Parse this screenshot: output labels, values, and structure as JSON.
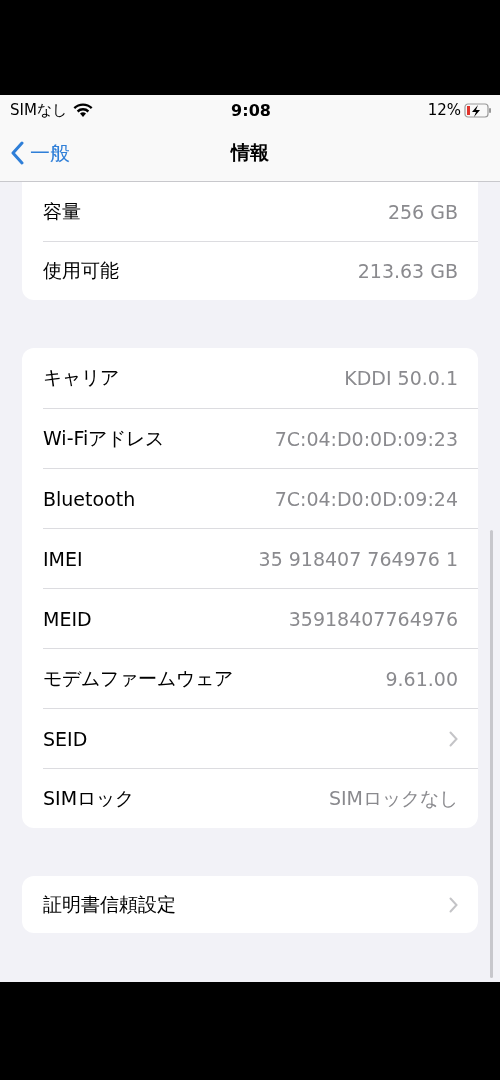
{
  "status_bar": {
    "carrier": "SIMなし",
    "time": "9:08",
    "battery": "12%",
    "charging": true
  },
  "nav": {
    "back": "一般",
    "title": "情報"
  },
  "groups": [
    {
      "rows": [
        {
          "kind": "value",
          "label": "容量",
          "value": "256 GB"
        },
        {
          "kind": "value",
          "label": "使用可能",
          "value": "213.63 GB"
        }
      ]
    },
    {
      "rows": [
        {
          "kind": "value",
          "label": "キャリア",
          "value": "KDDI 50.0.1"
        },
        {
          "kind": "value",
          "label": "Wi-Fiアドレス",
          "value": "7C:04:D0:0D:09:23"
        },
        {
          "kind": "value",
          "label": "Bluetooth",
          "value": "7C:04:D0:0D:09:24"
        },
        {
          "kind": "value",
          "label": "IMEI",
          "value": "35 918407 764976 1"
        },
        {
          "kind": "value",
          "label": "MEID",
          "value": "35918407764976"
        },
        {
          "kind": "value",
          "label": "モデムファームウェア",
          "value": "9.61.00"
        },
        {
          "kind": "chevron",
          "label": "SEID"
        },
        {
          "kind": "value",
          "label": "SIMロック",
          "value": "SIMロックなし"
        }
      ]
    },
    {
      "rows": [
        {
          "kind": "chevron",
          "label": "証明書信頼設定"
        }
      ]
    }
  ]
}
